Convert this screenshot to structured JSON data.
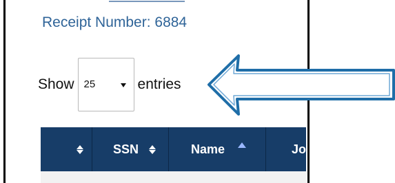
{
  "receipt": {
    "text": "Receipt Number: 6884"
  },
  "length_control": {
    "show_label": "Show",
    "selected_value": "25",
    "entries_label": "entries"
  },
  "table": {
    "headers": [
      "",
      "SSN",
      "Name",
      "Jo"
    ]
  },
  "colors": {
    "receipt_text": "#2f6498",
    "table_header_bg": "#173d68",
    "annotation_arrow": "#1f6ea8",
    "sort_ascending": "#9ab8ff"
  },
  "icons": {
    "sort_both": "sort-both-icon",
    "sort_ascending": "sort-ascending-icon",
    "dropdown": "chevron-down-icon",
    "annotation": "left-arrow-icon"
  }
}
